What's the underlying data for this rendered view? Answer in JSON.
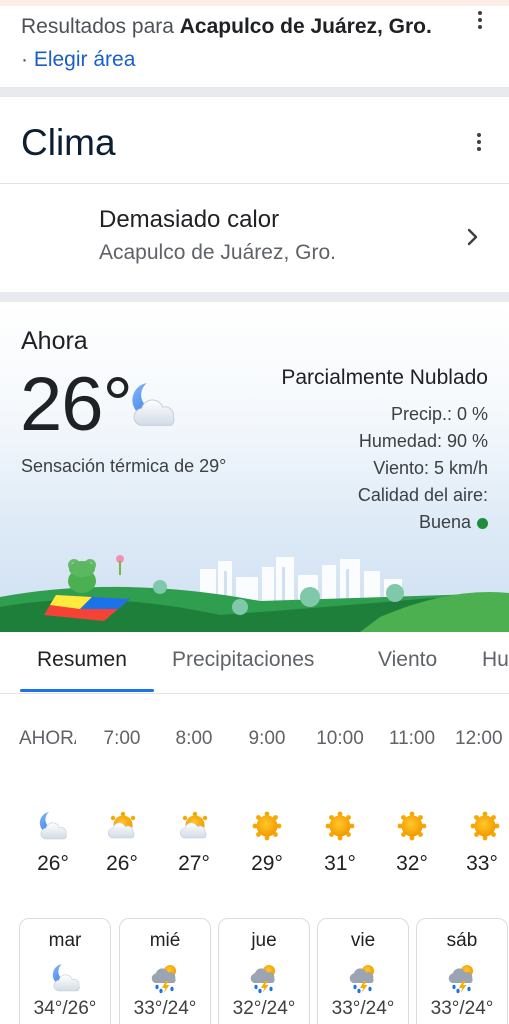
{
  "search_header": {
    "prefix": "Resultados para ",
    "location": "Acapulco de Juárez, Gro.",
    "separator": " · ",
    "change_area_link": "Elegir área"
  },
  "weather": {
    "title": "Clima",
    "alert": {
      "icon": "thermometer-icon",
      "title": "Demasiado calor",
      "location": "Acapulco de Juárez, Gro."
    },
    "now": {
      "label": "Ahora",
      "temperature": "26°",
      "icon": "moon-cloud-icon",
      "feels_like": "Sensación térmica de 29°",
      "condition": "Parcialmente Nublado",
      "precipitation": "Precip.: 0 %",
      "humidity": "Humedad: 90 %",
      "wind": "Viento: 5 km/h",
      "air_quality_label": "Calidad del aire:",
      "air_quality_value": "Buena",
      "air_quality_color": "#1e8e3e"
    },
    "tabs": [
      "Resumen",
      "Precipitaciones",
      "Viento",
      "Hu"
    ],
    "active_tab": "Resumen",
    "hourly": [
      {
        "time": "AHORA",
        "temp": "26°",
        "icon": "moon-cloud-icon"
      },
      {
        "time": "7:00",
        "temp": "26°",
        "icon": "sun-cloud-icon"
      },
      {
        "time": "8:00",
        "temp": "27°",
        "icon": "sun-cloud-icon"
      },
      {
        "time": "9:00",
        "temp": "29°",
        "icon": "sun-icon"
      },
      {
        "time": "10:00",
        "temp": "31°",
        "icon": "sun-icon"
      },
      {
        "time": "11:00",
        "temp": "32°",
        "icon": "sun-icon"
      },
      {
        "time": "12:00",
        "temp": "33°",
        "icon": "sun-icon"
      }
    ],
    "daily": [
      {
        "day": "mar",
        "temps": "34°/26°",
        "icon": "moon-cloud-icon"
      },
      {
        "day": "mié",
        "temps": "33°/24°",
        "icon": "thunderstorm-icon"
      },
      {
        "day": "jue",
        "temps": "32°/24°",
        "icon": "thunderstorm-icon"
      },
      {
        "day": "vie",
        "temps": "33°/24°",
        "icon": "thunderstorm-icon"
      },
      {
        "day": "sáb",
        "temps": "33°/24°",
        "icon": "thunderstorm-icon"
      }
    ]
  },
  "colors": {
    "link": "#1a5fc7",
    "accent": "#1a73e8",
    "sun": "#f9ab00",
    "alert_bg": "#fce8e6",
    "alert_icon": "#c5221f"
  }
}
